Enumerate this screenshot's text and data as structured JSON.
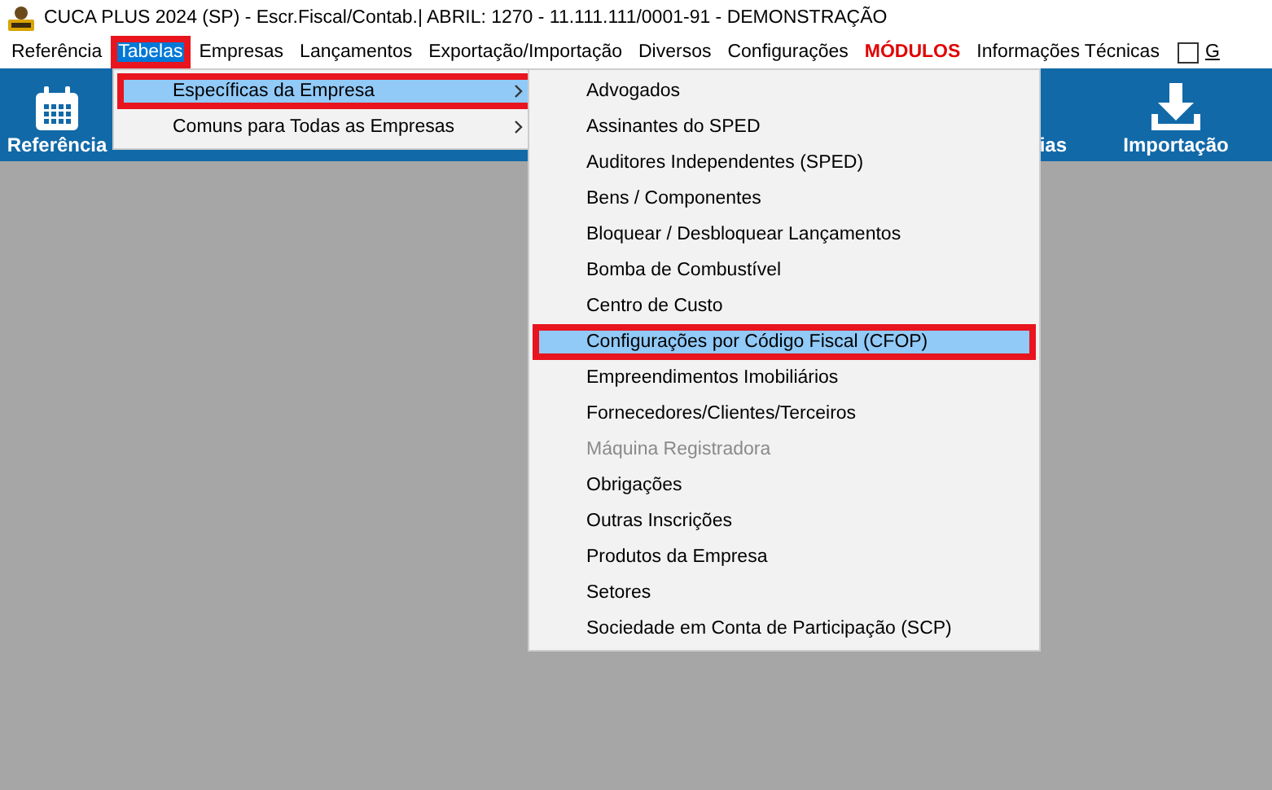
{
  "window": {
    "title": "CUCA PLUS 2024 (SP) - Escr.Fiscal/Contab.| ABRIL: 1270 - 11.111.111/0001-91 - DEMONSTRAÇÃO"
  },
  "menubar": [
    {
      "label": "Referência",
      "selected": false,
      "annotated": false,
      "kind": "menu"
    },
    {
      "label": "Tabelas",
      "selected": true,
      "annotated": true,
      "kind": "menu"
    },
    {
      "label": "Empresas",
      "selected": false,
      "annotated": false,
      "kind": "menu"
    },
    {
      "label": "Lançamentos",
      "selected": false,
      "annotated": false,
      "kind": "menu"
    },
    {
      "label": "Exportação/Importação",
      "selected": false,
      "annotated": false,
      "kind": "menu"
    },
    {
      "label": "Diversos",
      "selected": false,
      "annotated": false,
      "kind": "menu"
    },
    {
      "label": "Configurações",
      "selected": false,
      "annotated": false,
      "kind": "menu"
    },
    {
      "label": "MÓDULOS",
      "selected": false,
      "annotated": false,
      "kind": "emphasis"
    },
    {
      "label": "Informações Técnicas",
      "selected": false,
      "annotated": false,
      "kind": "menu"
    },
    {
      "label": "G",
      "selected": false,
      "annotated": false,
      "kind": "checkbox",
      "checked": false
    }
  ],
  "toolbar": [
    {
      "label": "Referência",
      "kind": "calendar"
    },
    {
      "label": "ias",
      "kind": "text"
    },
    {
      "label": "Importação",
      "kind": "download"
    }
  ],
  "menu": [
    {
      "label": "Específicas da Empresa",
      "selected": true,
      "annotated": true,
      "has_submenu": true
    },
    {
      "label": "Comuns para Todas as Empresas",
      "selected": false,
      "annotated": false,
      "has_submenu": true
    }
  ],
  "submenu": [
    {
      "label": "Advogados",
      "selected": false,
      "annotated": false,
      "disabled": false
    },
    {
      "label": "Assinantes do SPED",
      "selected": false,
      "annotated": false,
      "disabled": false
    },
    {
      "label": "Auditores Independentes (SPED)",
      "selected": false,
      "annotated": false,
      "disabled": false
    },
    {
      "label": "Bens / Componentes",
      "selected": false,
      "annotated": false,
      "disabled": false
    },
    {
      "label": "Bloquear / Desbloquear Lançamentos",
      "selected": false,
      "annotated": false,
      "disabled": false
    },
    {
      "label": "Bomba de Combustível",
      "selected": false,
      "annotated": false,
      "disabled": false
    },
    {
      "label": "Centro de Custo",
      "selected": false,
      "annotated": false,
      "disabled": false
    },
    {
      "label": "Configurações por Código Fiscal (CFOP)",
      "selected": true,
      "annotated": true,
      "disabled": false
    },
    {
      "label": "Empreendimentos Imobiliários",
      "selected": false,
      "annotated": false,
      "disabled": false
    },
    {
      "label": "Fornecedores/Clientes/Terceiros",
      "selected": false,
      "annotated": false,
      "disabled": false
    },
    {
      "label": "Máquina Registradora",
      "selected": false,
      "annotated": false,
      "disabled": true
    },
    {
      "label": "Obrigações",
      "selected": false,
      "annotated": false,
      "disabled": false
    },
    {
      "label": "Outras Inscrições",
      "selected": false,
      "annotated": false,
      "disabled": false
    },
    {
      "label": "Produtos da Empresa",
      "selected": false,
      "annotated": false,
      "disabled": false
    },
    {
      "label": "Setores",
      "selected": false,
      "annotated": false,
      "disabled": false
    },
    {
      "label": "Sociedade em Conta de Participação (SCP)",
      "selected": false,
      "annotated": false,
      "disabled": false
    }
  ]
}
